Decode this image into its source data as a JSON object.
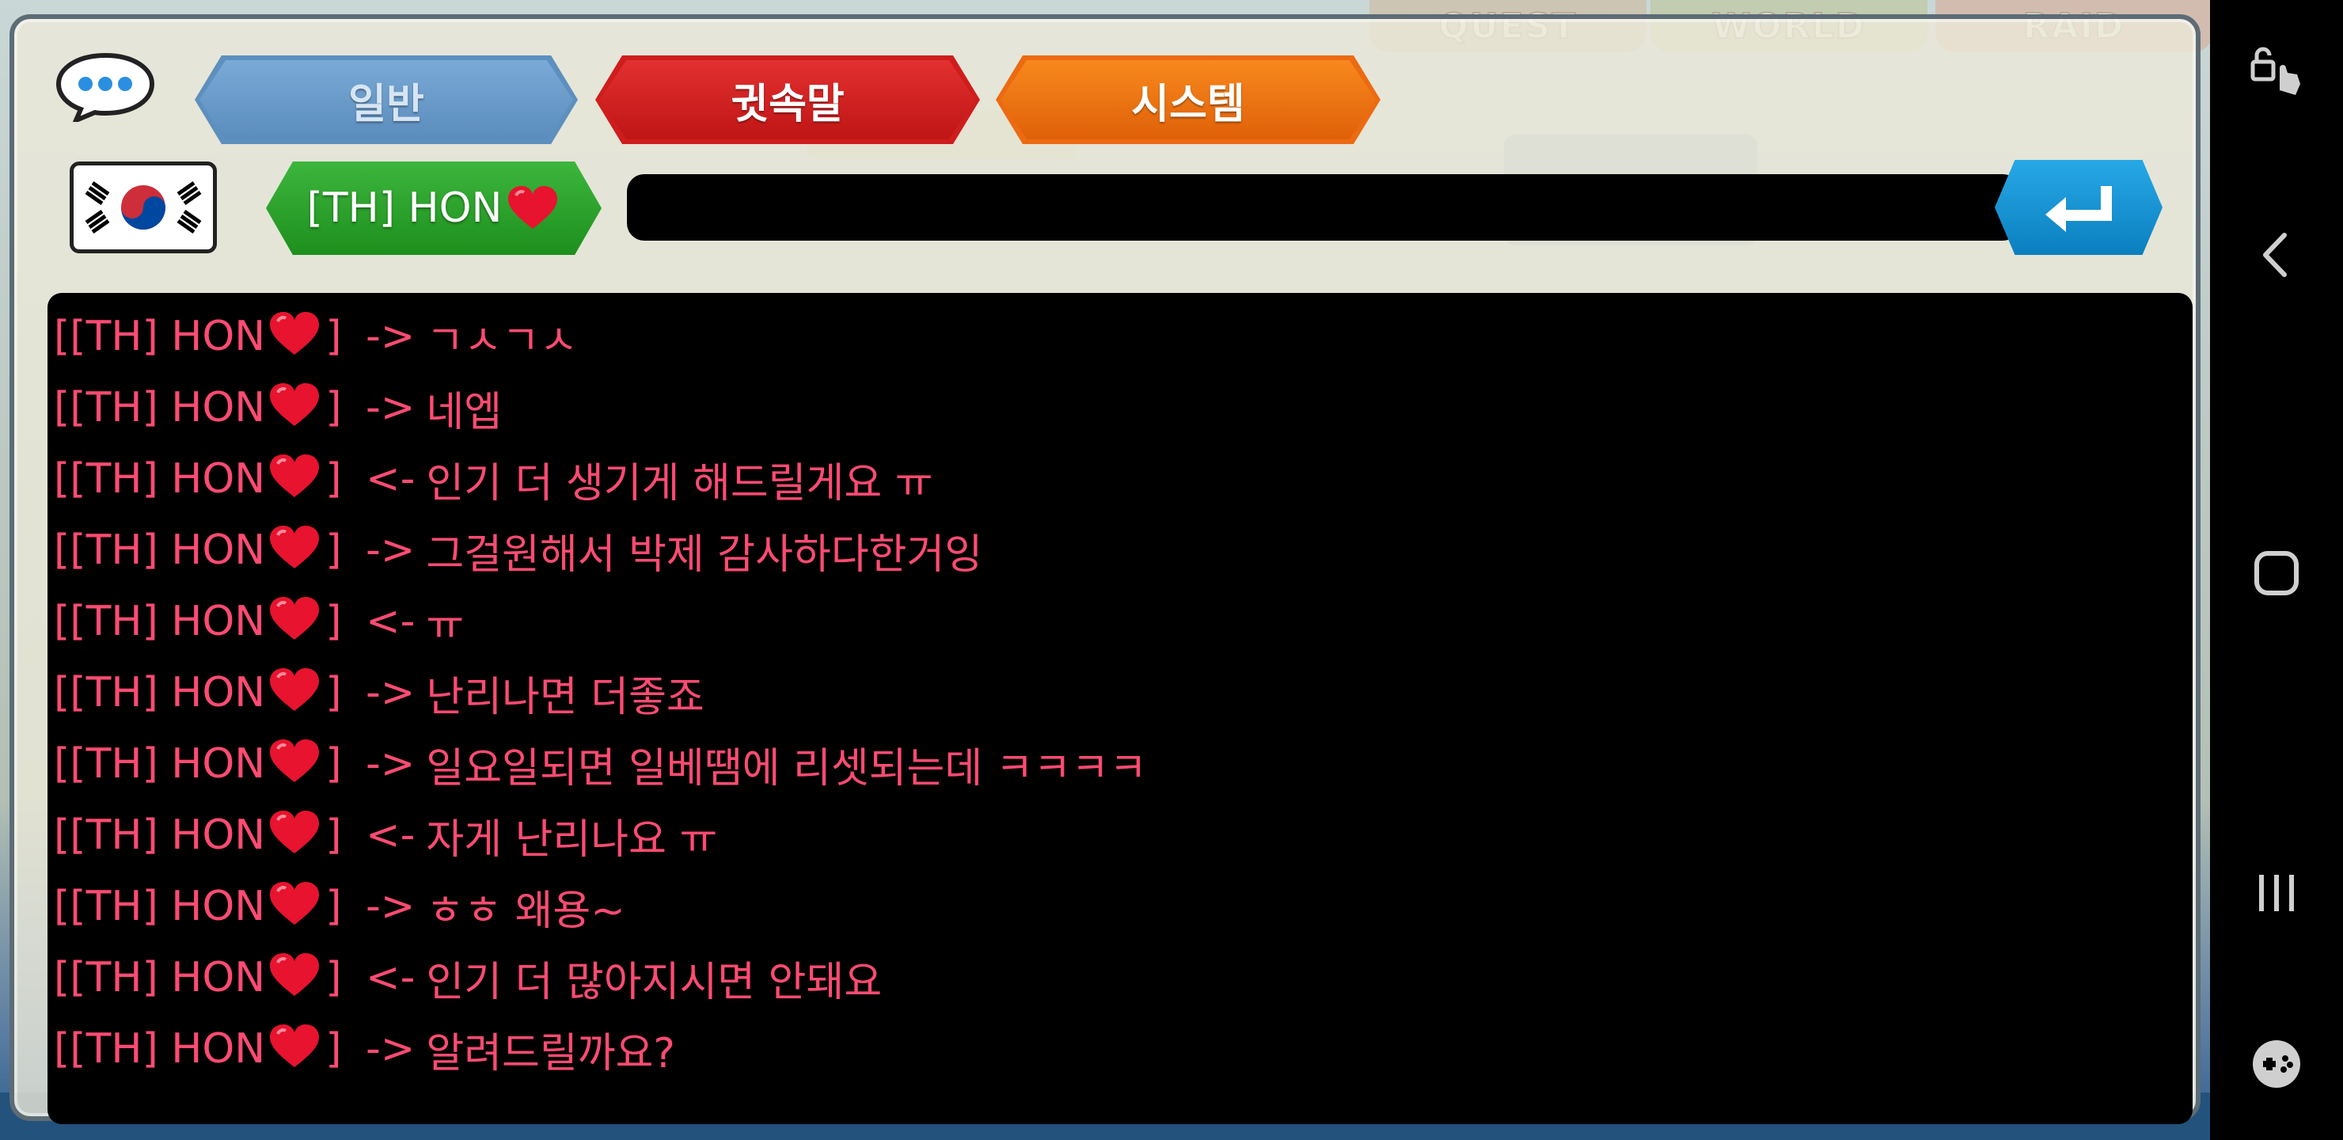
{
  "game": {
    "top_tabs": [
      "QUEST",
      "WORLD",
      "RAID"
    ]
  },
  "chat": {
    "mode_tabs": [
      "일반",
      "귓속말",
      "시스템"
    ],
    "recipient": "[TH] HON",
    "input_value": "",
    "messages": [
      {
        "prefix": "[[TH] HON",
        "suffix": "] ",
        "arrow": "->",
        "text": "ㄱㅅㄱㅅ"
      },
      {
        "prefix": "[[TH] HON",
        "suffix": "] ",
        "arrow": "->",
        "text": "네엡"
      },
      {
        "prefix": "[[TH] HON",
        "suffix": "] ",
        "arrow": "<-",
        "text": "인기 더 생기게 해드릴게요 ㅠ"
      },
      {
        "prefix": "[[TH] HON",
        "suffix": "] ",
        "arrow": "->",
        "text": "그걸원해서 박제 감사하다한거잉"
      },
      {
        "prefix": "[[TH] HON",
        "suffix": "] ",
        "arrow": "<-",
        "text": "ㅠ"
      },
      {
        "prefix": "[[TH] HON",
        "suffix": "] ",
        "arrow": "->",
        "text": "난리나면 더좋죠"
      },
      {
        "prefix": "[[TH] HON",
        "suffix": "] ",
        "arrow": "->",
        "text": "일요일되면 일베땜에 리셋되는데 ㅋㅋㅋㅋ"
      },
      {
        "prefix": "[[TH] HON",
        "suffix": "] ",
        "arrow": "<-",
        "text": "자게 난리나요 ㅠ"
      },
      {
        "prefix": "[[TH] HON",
        "suffix": "] ",
        "arrow": "->",
        "text": "ㅎㅎ 왜용~"
      },
      {
        "prefix": "[[TH] HON",
        "suffix": "] ",
        "arrow": "<-",
        "text": "인기 더 많아지시면 안돼요"
      },
      {
        "prefix": "[[TH] HON",
        "suffix": "] ",
        "arrow": "->",
        "text": "알려드릴까요?"
      }
    ]
  },
  "icons": {
    "chat": "speech-bubble-icon",
    "flag": "korea-flag-icon",
    "heart": "red-heart-icon",
    "send": "enter-arrow-icon",
    "nav": [
      "pinch-lock-icon",
      "back-icon",
      "home-icon",
      "recents-icon",
      "game-tools-icon"
    ]
  },
  "colors": {
    "message_text": "#ff4b72",
    "whisper_tab": "#cf1d1d",
    "system_tab": "#ec6a12",
    "general_tab": "#5d8fbf",
    "recipient_tag": "#2aa32a",
    "send_button": "#169bd9"
  }
}
